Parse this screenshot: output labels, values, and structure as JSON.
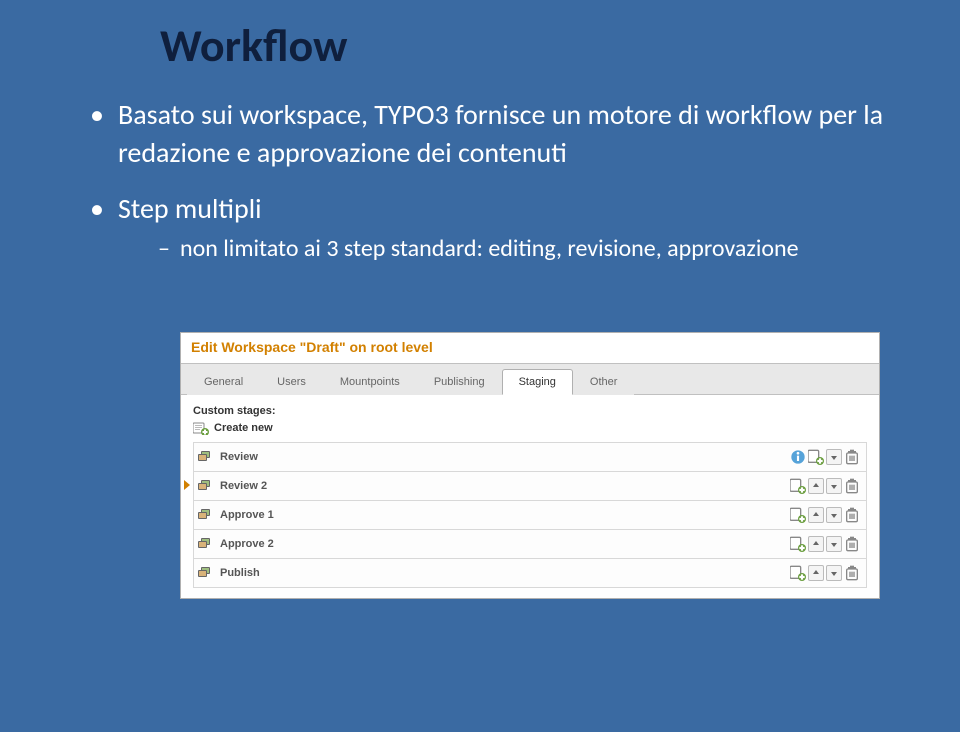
{
  "title": "Workflow",
  "bullets": {
    "b1": "Basato sui workspace, TYPO3 fornisce un motore di workflow per la redazione e approvazione dei contenuti",
    "b2": "Step multipli",
    "b2_sub": "non limitato ai 3 step standard: editing, revisione, approvazione"
  },
  "panel": {
    "title": "Edit Workspace \"Draft\" on root level",
    "tabs": [
      "General",
      "Users",
      "Mountpoints",
      "Publishing",
      "Staging",
      "Other"
    ],
    "active_tab": "Staging",
    "section": "Custom stages:",
    "create_new": "Create new",
    "rows": [
      {
        "label": "Review",
        "actions": [
          "info",
          "add",
          "down",
          "delete"
        ],
        "marker": false
      },
      {
        "label": "Review 2",
        "actions": [
          "add",
          "up",
          "down",
          "delete"
        ],
        "marker": true
      },
      {
        "label": "Approve 1",
        "actions": [
          "add",
          "up",
          "down",
          "delete"
        ],
        "marker": false
      },
      {
        "label": "Approve 2",
        "actions": [
          "add",
          "up",
          "down",
          "delete"
        ],
        "marker": false
      },
      {
        "label": "Publish",
        "actions": [
          "add",
          "up",
          "down",
          "delete"
        ],
        "marker": false
      }
    ]
  }
}
